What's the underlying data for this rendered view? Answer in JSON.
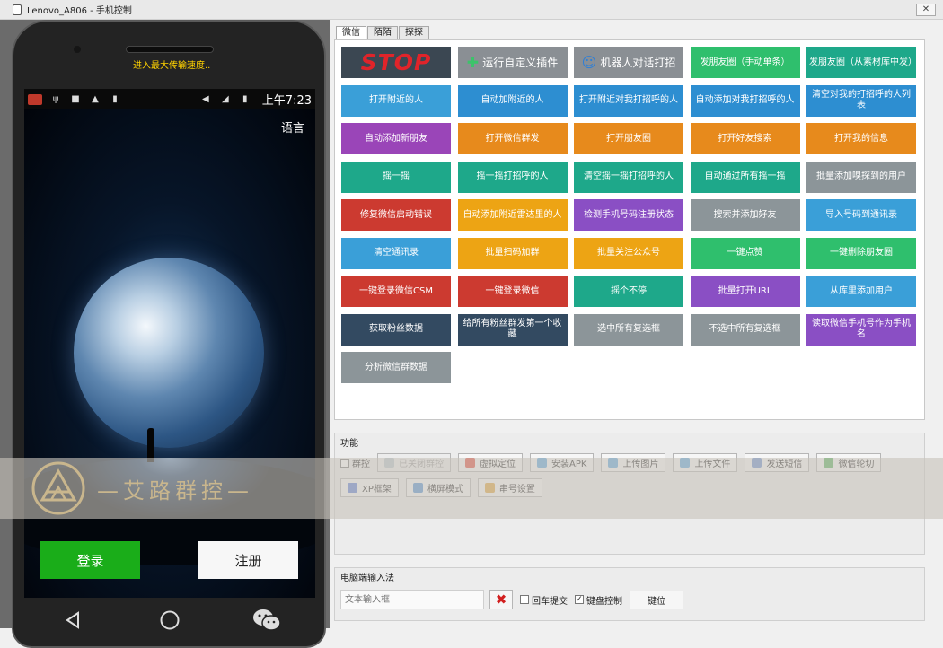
{
  "window": {
    "title": "Lenovo_A806 - 手机控制",
    "close_glyph": "✕"
  },
  "phone": {
    "toast": "进入最大传输速度..",
    "status": {
      "clock": "上午7:23"
    },
    "screen": {
      "language": "语言",
      "login": "登录",
      "register": "注册"
    }
  },
  "tabs": [
    {
      "label": "微信",
      "active": true
    },
    {
      "label": "陌陌",
      "active": false
    },
    {
      "label": "探探",
      "active": false
    }
  ],
  "tiles": [
    {
      "label": "STOP",
      "color": "stop"
    },
    {
      "label": "运行自定义插件",
      "color": "img",
      "icon": "puzzle-icon"
    },
    {
      "label": "机器人对话打招",
      "color": "img",
      "icon": "robot-icon"
    },
    {
      "label": "发朋友圈（手动单条）",
      "color": "green"
    },
    {
      "label": "发朋友圈（从素材库中发）",
      "color": "teal"
    },
    {
      "label": "打开附近的人",
      "color": "lblue"
    },
    {
      "label": "自动加附近的人",
      "color": "blue"
    },
    {
      "label": "打开附近对我打招呼的人",
      "color": "blue"
    },
    {
      "label": "自动添加对我打招呼的人",
      "color": "blue"
    },
    {
      "label": "清空对我的打招呼的人列表",
      "color": "blue"
    },
    {
      "label": "自动添加新朋友",
      "color": "purple"
    },
    {
      "label": "打开微信群发",
      "color": "orange"
    },
    {
      "label": "打开朋友圈",
      "color": "orange"
    },
    {
      "label": "打开好友搜索",
      "color": "orange"
    },
    {
      "label": "打开我的信息",
      "color": "orange"
    },
    {
      "label": "摇一摇",
      "color": "teal"
    },
    {
      "label": "摇一摇打招呼的人",
      "color": "teal"
    },
    {
      "label": "清空摇一摇打招呼的人",
      "color": "teal"
    },
    {
      "label": "自动通过所有摇一摇",
      "color": "teal"
    },
    {
      "label": "批量添加嗅探到的用户",
      "color": "grey"
    },
    {
      "label": "修复微信启动错误",
      "color": "red"
    },
    {
      "label": "自动添加附近雷达里的人",
      "color": "gold"
    },
    {
      "label": "检测手机号码注册状态",
      "color": "violet"
    },
    {
      "label": "搜索并添加好友",
      "color": "grey"
    },
    {
      "label": "导入号码到通讯录",
      "color": "lblue"
    },
    {
      "label": "清空通讯录",
      "color": "lblue"
    },
    {
      "label": "批量扫码加群",
      "color": "gold"
    },
    {
      "label": "批量关注公众号",
      "color": "gold"
    },
    {
      "label": "一键点赞",
      "color": "green"
    },
    {
      "label": "一键删除朋友圈",
      "color": "green"
    },
    {
      "label": "一键登录微信CSM",
      "color": "red"
    },
    {
      "label": "一键登录微信",
      "color": "red"
    },
    {
      "label": "摇个不停",
      "color": "teal"
    },
    {
      "label": "批量打开URL",
      "color": "violet"
    },
    {
      "label": "从库里添加用户",
      "color": "lblue"
    },
    {
      "label": "获取粉丝数据",
      "color": "navy"
    },
    {
      "label": "给所有粉丝群发第一个收藏",
      "color": "navy"
    },
    {
      "label": "选中所有复选框",
      "color": "grey"
    },
    {
      "label": "不选中所有复选框",
      "color": "grey"
    },
    {
      "label": "读取微信手机号作为手机名",
      "color": "violet"
    },
    {
      "label": "分析微信群数据",
      "color": "grey"
    }
  ],
  "functions": {
    "title": "功能",
    "group_control": "群控",
    "row1": [
      {
        "label": "已关闭群控",
        "icon": "grid-icon",
        "disabled": true
      },
      {
        "label": "虚拟定位",
        "icon": "location-icon"
      },
      {
        "label": "安装APK",
        "icon": "install-icon"
      },
      {
        "label": "上传图片",
        "icon": "upload-image-icon"
      },
      {
        "label": "上传文件",
        "icon": "upload-file-icon"
      },
      {
        "label": "发送短信",
        "icon": "sms-icon"
      },
      {
        "label": "微信轮切",
        "icon": "switch-icon"
      }
    ],
    "row2": [
      {
        "label": "XP框架",
        "icon": "xp-icon"
      },
      {
        "label": "横屏模式",
        "icon": "rotate-icon"
      },
      {
        "label": "串号设置",
        "icon": "imei-icon"
      }
    ]
  },
  "input_method": {
    "title": "电脑端输入法",
    "placeholder": "文本输入框",
    "enter_submit": "回车提交",
    "keyboard_control": "键盘控制",
    "keyboard_checked": true,
    "key_pos": "键位"
  },
  "watermark": {
    "text": "—艾路群控—"
  },
  "colors": {
    "stop_text": "#e0242a",
    "login_green": "#1aad19",
    "toast_yellow": "#ffd200"
  }
}
